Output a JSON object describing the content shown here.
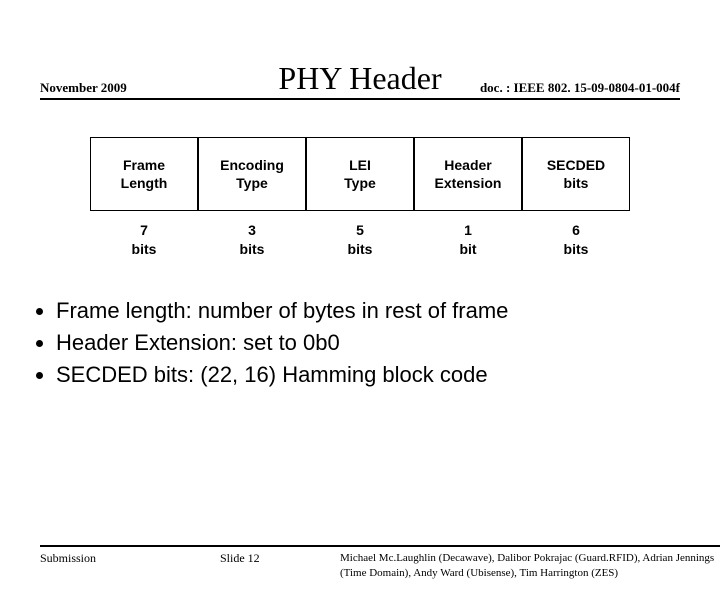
{
  "header": {
    "date": "November 2009",
    "doc": "doc. : IEEE 802. 15-09-0804-01-004f"
  },
  "title": "PHY Header",
  "fields": [
    {
      "name": "Frame\nLength",
      "bits": "7\nbits"
    },
    {
      "name": "Encoding\nType",
      "bits": "3\nbits"
    },
    {
      "name": "LEI\nType",
      "bits": "5\nbits"
    },
    {
      "name": "Header\nExtension",
      "bits": "1\nbit"
    },
    {
      "name": "SECDED\nbits",
      "bits": "6\nbits"
    }
  ],
  "bullets": [
    "Frame length: number of bytes in rest of frame",
    "Header Extension: set to 0b0",
    "SECDED bits: (22, 16) Hamming block code"
  ],
  "footer": {
    "left": "Submission",
    "center": "Slide 12",
    "right": "Michael Mc.Laughlin (Decawave), Dalibor Pokrajac (Guard.RFID), Adrian Jennings (Time Domain), Andy Ward (Ubisense), Tim Harrington (ZES)"
  }
}
